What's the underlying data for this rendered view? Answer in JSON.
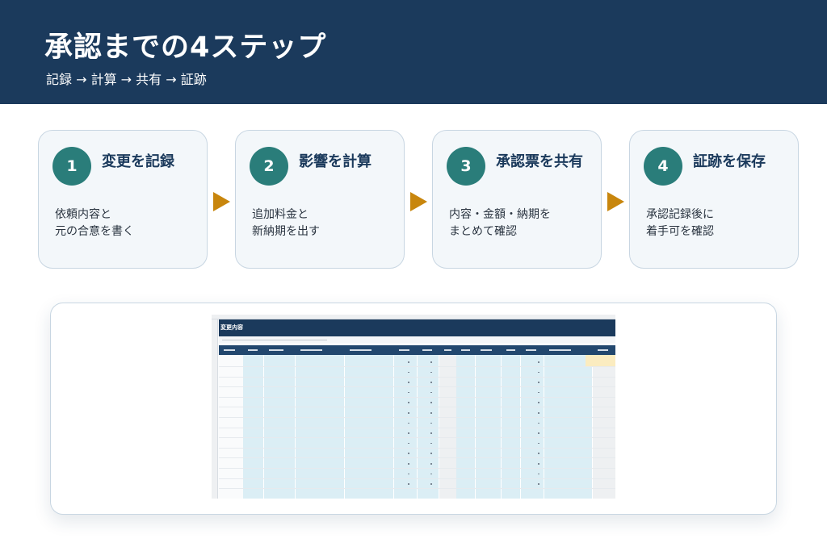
{
  "header": {
    "title": "承認までの4ステップ",
    "subtitle": "記録 → 計算 → 共有 → 証跡"
  },
  "steps": [
    {
      "number": "1",
      "title": "変更を記録",
      "desc_line1": "依頼内容と",
      "desc_line2": "元の合意を書く"
    },
    {
      "number": "2",
      "title": "影響を計算",
      "desc_line1": "追加料金と",
      "desc_line2": "新納期を出す"
    },
    {
      "number": "3",
      "title": "承認票を共有",
      "desc_line1": "内容・金額・納期を",
      "desc_line2": "まとめて確認"
    },
    {
      "number": "4",
      "title": "証跡を保存",
      "desc_line1": "承認記録後に",
      "desc_line2": "着手可を確認"
    }
  ],
  "sheet": {
    "banner_title": "変更内容"
  },
  "colors": {
    "navy": "#1b3a5c",
    "teal": "#2a7d7a",
    "arrow": "#c8860d",
    "card_bg": "#f3f7fa"
  }
}
